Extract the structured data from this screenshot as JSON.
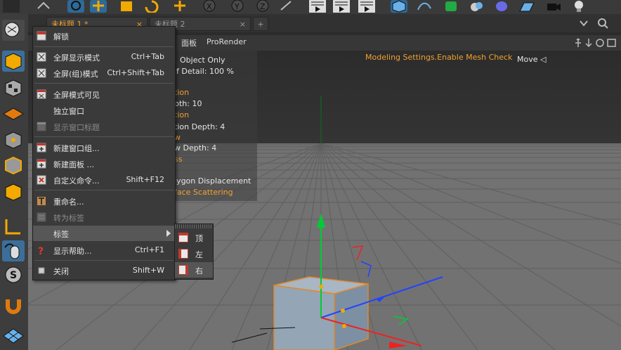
{
  "tabs": [
    {
      "label": "未标题 1 *",
      "close": "×",
      "active": true
    },
    {
      "label": "未标题 2",
      "close": "×",
      "active": false
    }
  ],
  "new_tab_label": "+",
  "viewport_menu": {
    "panel": "面板",
    "prorender": "ProRender"
  },
  "hud": {
    "object_only": "Object Only",
    "level_of_detail": "f Detail:  100 %",
    "tion1": "tion",
    "depth": "pth:  10",
    "tion2": "tion",
    "tion_depth": "tion Depth:  4",
    "w1": "w",
    "w_depth": "w Depth:  4",
    "ss": "ss",
    "polygon_displacement": "lygon Displacement",
    "face_scattering": "face Scattering",
    "modeling_settings": "Modeling Settings.Enable Mesh Check",
    "move": "Move ◁"
  },
  "menu": {
    "unlock": "解锁",
    "fullscreen": {
      "label": "全屏显示模式",
      "shortcut": "Ctrl+Tab"
    },
    "fullscreen_group": {
      "label": "全屏(组)模式",
      "shortcut": "Ctrl+Shift+Tab"
    },
    "fullscreen_visible": "全屏模式可见",
    "detach_window": "独立窗口",
    "show_window_title": "显示窗口标题",
    "new_window_group": "新建窗口组...",
    "new_panel": "新建面板 ...",
    "custom_command": {
      "label": "自定义命令...",
      "shortcut": "Shift+F12"
    },
    "rename": "重命名...",
    "convert_to_tab": "转为标签",
    "tabs": "标签",
    "show_help": {
      "label": "显示帮助...",
      "shortcut": "Ctrl+F1"
    },
    "close": {
      "label": "关闭",
      "shortcut": "Shift+W"
    }
  },
  "submenu": {
    "top": "顶",
    "left": "左",
    "right": "右"
  },
  "colors": {
    "hud_orange": "#f0a030",
    "axis_green": "#00cc33",
    "axis_blue": "#2244ff",
    "axis_red": "#ee2222",
    "selection_orange": "#e08a2a"
  }
}
